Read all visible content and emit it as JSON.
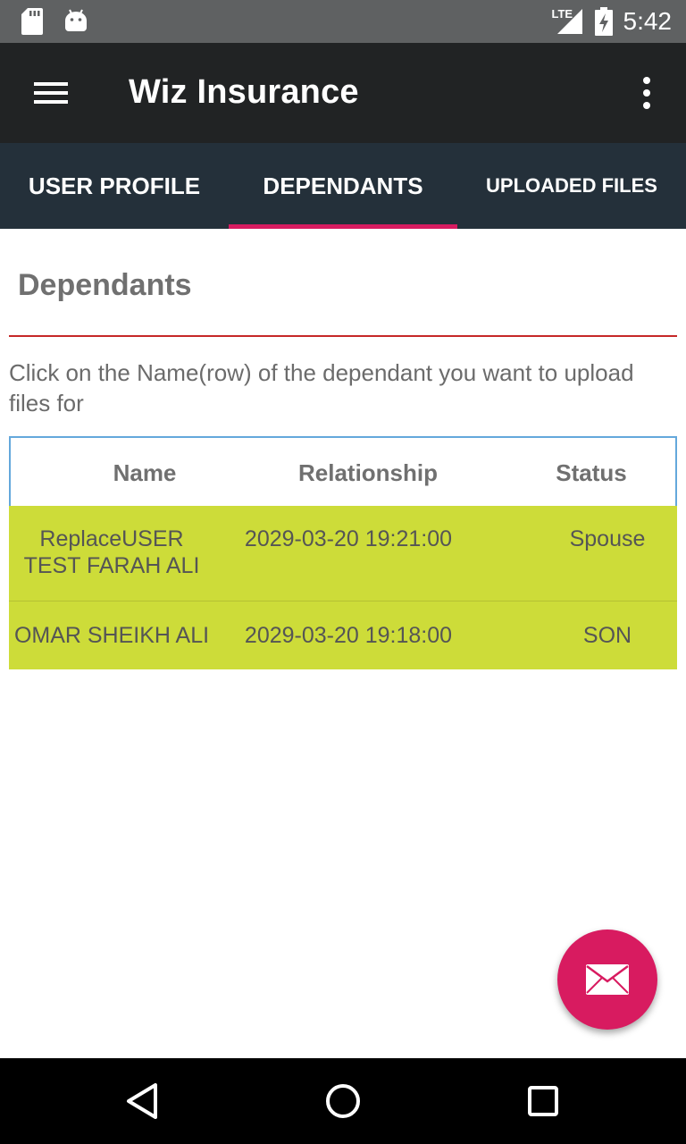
{
  "status_bar": {
    "time": "5:42",
    "network_label": "LTE",
    "icons": [
      "sd-card-icon",
      "android-icon",
      "signal-icon",
      "battery-charging-icon"
    ]
  },
  "app_bar": {
    "title": "Wiz Insurance",
    "menu_icon": "hamburger-menu-icon",
    "overflow_icon": "more-vert-icon"
  },
  "tabs": [
    {
      "label": "USER PROFILE",
      "selected": false
    },
    {
      "label": "DEPENDANTS",
      "selected": true
    },
    {
      "label": "UPLOADED FILES",
      "selected": false
    }
  ],
  "content": {
    "section_title": "Dependants",
    "instructions": "Click on the Name(row) of the dependant you want to upload files for"
  },
  "table": {
    "headers": [
      "Name",
      "Relationship",
      "Status"
    ],
    "rows": [
      {
        "name": "ReplaceUSER TEST FARAH ALI",
        "relationship": "2029-03-20 19:21:00",
        "status": "Spouse"
      },
      {
        "name": "OMAR SHEIKH ALI",
        "relationship": "2029-03-20 19:18:00",
        "status": "SON"
      }
    ]
  },
  "fab": {
    "icon": "mail-icon"
  },
  "nav_bar": {
    "icons": [
      "back-icon",
      "home-icon",
      "recents-icon"
    ]
  },
  "colors": {
    "status_bar": "#5f6162",
    "app_bar": "#212324",
    "tab_bar": "#24303a",
    "accent": "#d81b60",
    "row_highlight": "#cddc39",
    "divider": "#c62828",
    "table_border": "#64a8dc"
  }
}
